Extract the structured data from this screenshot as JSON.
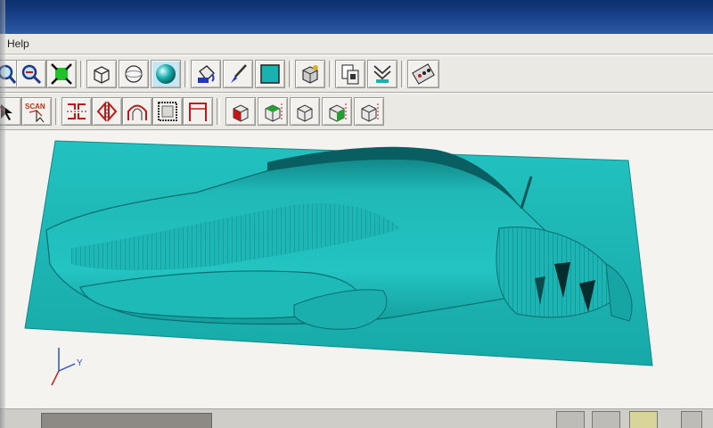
{
  "menu": {
    "help_label": "Help"
  },
  "toolbar1": {
    "buttons": [
      {
        "icon": "zoom-in-icon"
      },
      {
        "icon": "zoom-out-icon"
      },
      {
        "icon": "zoom-fit-icon"
      },
      {
        "icon": "wireframe-cube-icon"
      },
      {
        "icon": "hidden-line-sphere-icon"
      },
      {
        "icon": "shaded-sphere-icon"
      },
      {
        "icon": "paint-bucket-icon"
      },
      {
        "icon": "paint-brush-icon"
      },
      {
        "icon": "color-swatch-icon"
      },
      {
        "icon": "cube-info-icon"
      },
      {
        "icon": "copy-document-icon"
      },
      {
        "icon": "mesh-conversion-icon"
      },
      {
        "icon": "settings-panel-icon"
      }
    ]
  },
  "toolbar2": {
    "scan_label": "SCAN",
    "buttons": [
      {
        "icon": "select-arrow-icon"
      },
      {
        "icon": "scan-icon"
      },
      {
        "icon": "mirror-horizontal-icon"
      },
      {
        "icon": "mirror-vertical-icon"
      },
      {
        "icon": "revolve-arch-icon"
      },
      {
        "icon": "grid-frame-icon"
      },
      {
        "icon": "portal-frame-icon"
      },
      {
        "icon": "front-view-icon"
      },
      {
        "icon": "top-view-icon"
      },
      {
        "icon": "side-view-icon"
      },
      {
        "icon": "back-view-icon"
      },
      {
        "icon": "iso-view-icon"
      }
    ]
  },
  "viewport": {
    "model_color": "#1ab2b0",
    "axis": {
      "y_label": "Y"
    }
  },
  "colors": {
    "titlebar": "#1d4790",
    "toolbar_bg": "#ebe9e4",
    "model_teal": "#1ab2b0",
    "model_shadow": "#0b6f70"
  }
}
